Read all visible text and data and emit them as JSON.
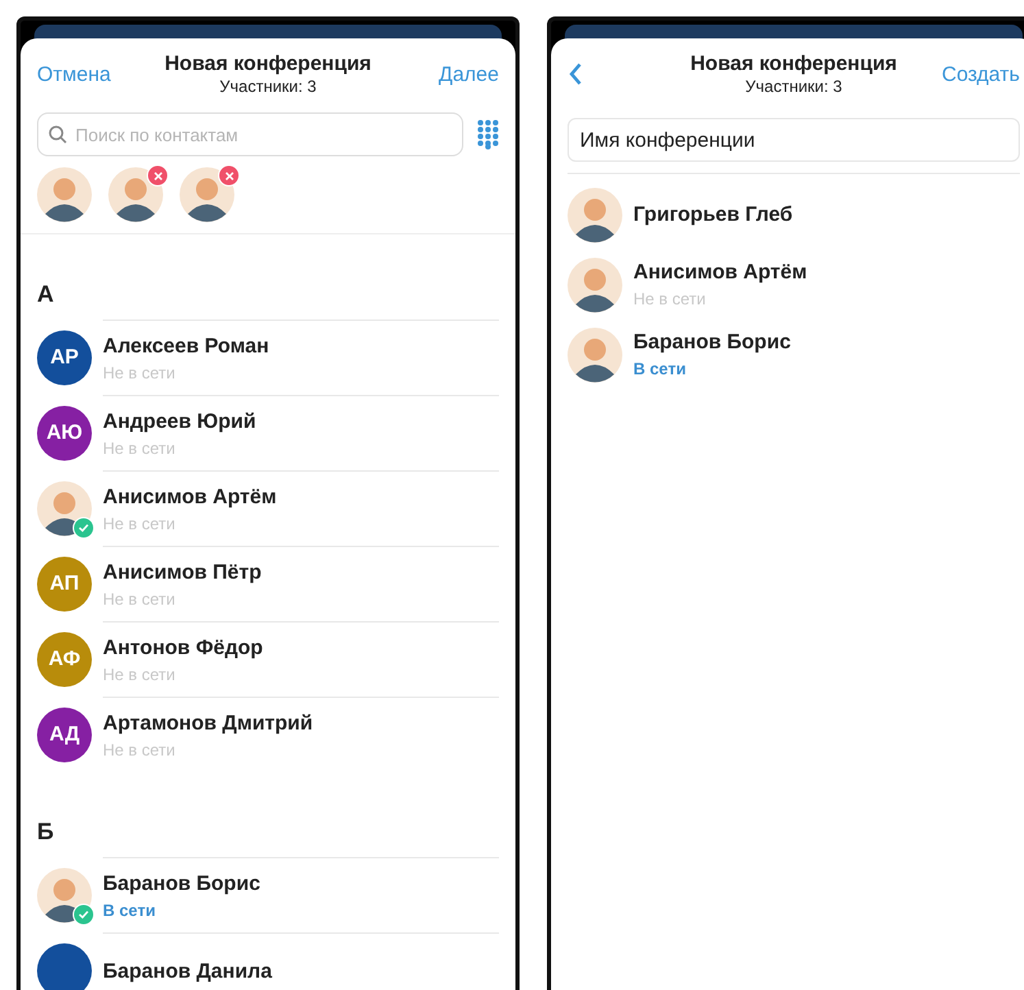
{
  "new_conference": {
    "cancel": "Отмена",
    "title": "Новая конференция",
    "subtitle": "Участники: 3",
    "next": "Далее",
    "search": {
      "placeholder": "Поиск по контактам"
    },
    "chosen": [
      {
        "removable": false
      },
      {
        "removable": true
      },
      {
        "removable": true
      }
    ],
    "sections": [
      {
        "letter": "А",
        "contacts": [
          {
            "name": "Алексеев Роман",
            "avatar": {
              "kind": "initials",
              "initials": "АР",
              "color": "#134f9c"
            },
            "status": "Не в сети",
            "online": false,
            "selected": false
          },
          {
            "name": "Андреев Юрий",
            "avatar": {
              "kind": "initials",
              "initials": "АЮ",
              "color": "#8620a3"
            },
            "status": "Не в сети",
            "online": false,
            "selected": false
          },
          {
            "name": "Анисимов Артём",
            "avatar": {
              "kind": "photo"
            },
            "status": "Не в сети",
            "online": false,
            "selected": true
          },
          {
            "name": "Анисимов Пётр",
            "avatar": {
              "kind": "initials",
              "initials": "АП",
              "color": "#b88c0b"
            },
            "status": "Не в сети",
            "online": false,
            "selected": false
          },
          {
            "name": "Антонов Фёдор",
            "avatar": {
              "kind": "initials",
              "initials": "АФ",
              "color": "#b88c0b"
            },
            "status": "Не в сети",
            "online": false,
            "selected": false
          },
          {
            "name": "Артамонов Дмитрий",
            "avatar": {
              "kind": "initials",
              "initials": "АД",
              "color": "#8620a3"
            },
            "status": "Не в сети",
            "online": false,
            "selected": false
          }
        ]
      },
      {
        "letter": "Б",
        "contacts": [
          {
            "name": "Баранов Борис",
            "avatar": {
              "kind": "photo"
            },
            "status": "В сети",
            "online": true,
            "selected": true
          },
          {
            "name": "Баранов Данила",
            "avatar": {
              "kind": "initials",
              "color": "#134f9c"
            },
            "selected": false
          }
        ]
      }
    ]
  },
  "create_conference": {
    "title": "Новая конференция",
    "subtitle": "Участники: 3",
    "create": "Создать",
    "name_field": {
      "value": "Имя конференции"
    },
    "participants": [
      {
        "name": "Григорьев Глеб"
      },
      {
        "name": "Анисимов Артём",
        "status": "Не в сети",
        "online": false
      },
      {
        "name": "Баранов Борис",
        "status": "В сети",
        "online": true
      }
    ]
  }
}
